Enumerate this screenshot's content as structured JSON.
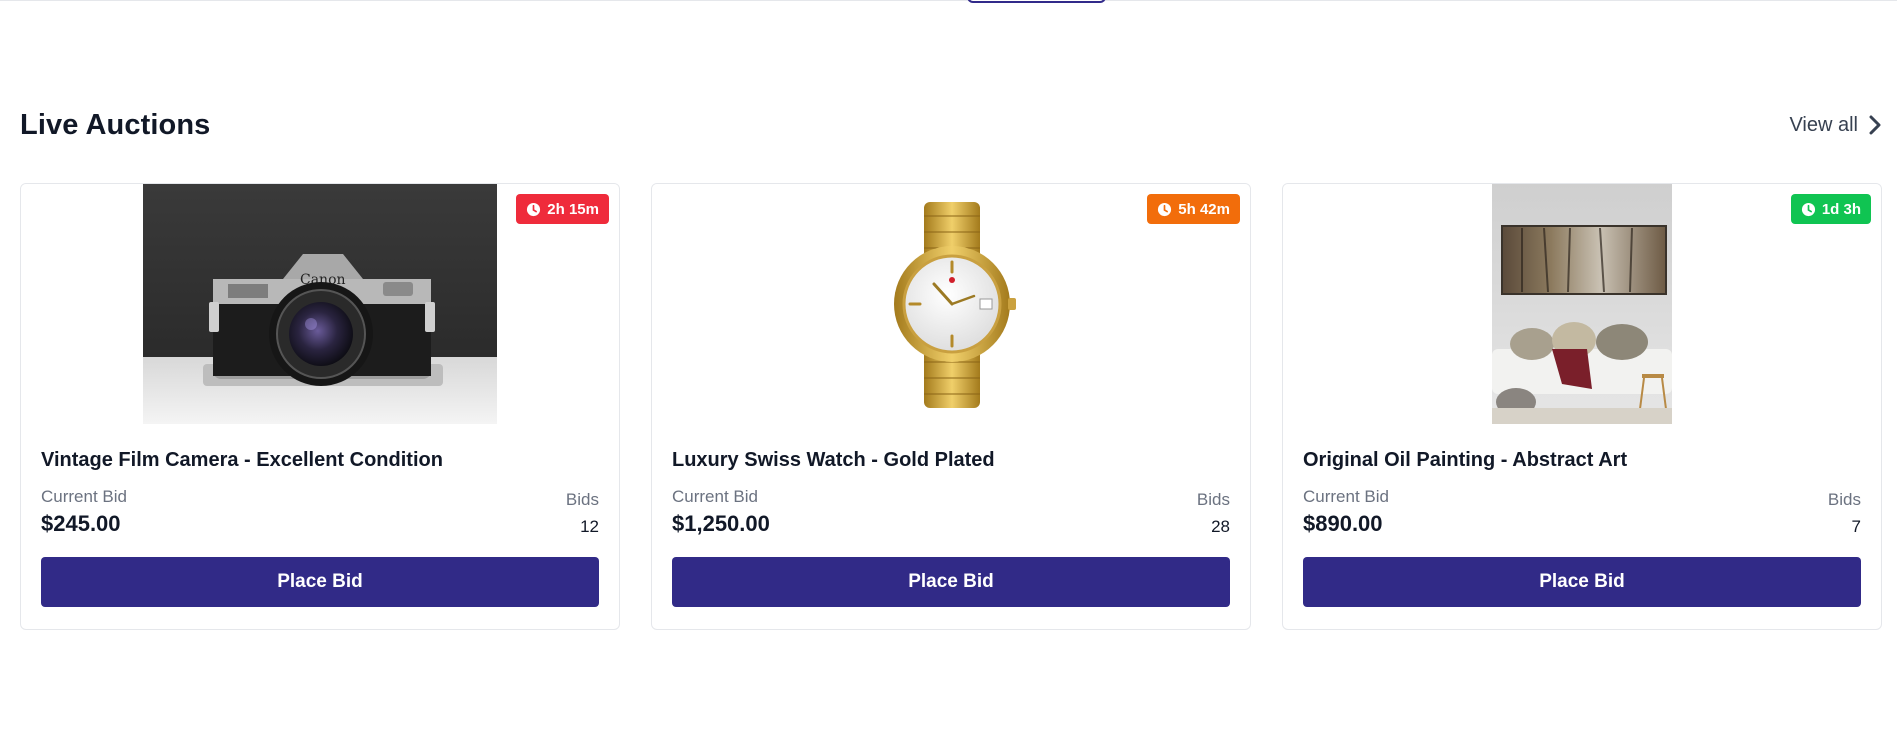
{
  "section": {
    "title": "Live Auctions",
    "view_all_label": "View all"
  },
  "labels": {
    "current_bid": "Current Bid",
    "bids": "Bids",
    "place_bid": "Place Bid"
  },
  "colors": {
    "primary": "#312a87",
    "badge_red": "#ef2b3b",
    "badge_orange": "#f26d0b",
    "badge_green": "#10c452"
  },
  "auctions": [
    {
      "title": "Vintage Film Camera - Excellent Condition",
      "current_bid": "$245.00",
      "bids": "12",
      "time_left": "2h 15m",
      "badge_color": "#ef2b3b",
      "image": "camera"
    },
    {
      "title": "Luxury Swiss Watch - Gold Plated",
      "current_bid": "$1,250.00",
      "bids": "28",
      "time_left": "5h 42m",
      "badge_color": "#f26d0b",
      "image": "watch"
    },
    {
      "title": "Original Oil Painting - Abstract Art",
      "current_bid": "$890.00",
      "bids": "7",
      "time_left": "1d 3h",
      "badge_color": "#10c452",
      "image": "painting"
    }
  ]
}
